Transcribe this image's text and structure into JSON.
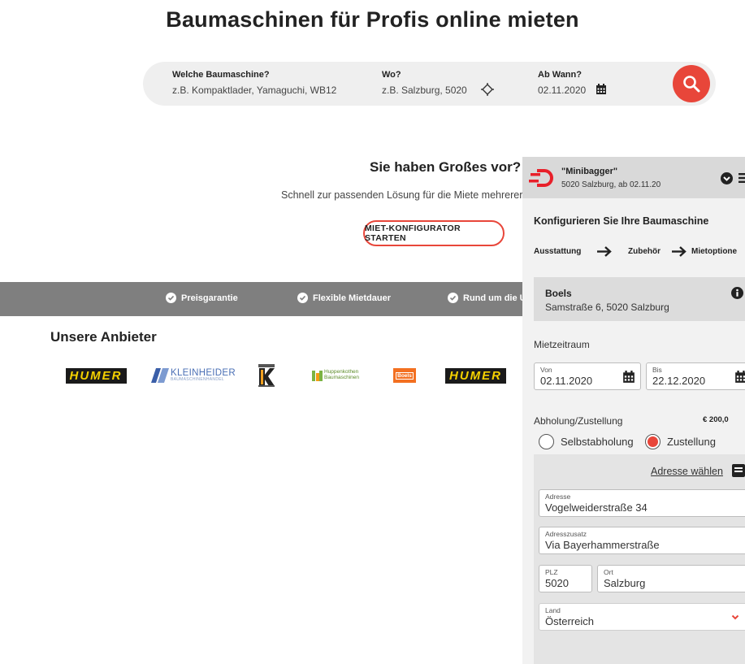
{
  "page_title": "Baumaschinen für Profis online mieten",
  "search": {
    "machine_label": "Welche Baumaschine?",
    "machine_placeholder": "z.B. Kompaktlader, Yamaguchi, WB12",
    "location_label": "Wo?",
    "location_placeholder": "z.B. Salzburg, 5020",
    "date_label": "Ab Wann?",
    "date_value": "02.11.2020",
    "location_icon": "crosshair-icon",
    "date_icon": "calendar-icon",
    "search_icon": "search-icon"
  },
  "promo": {
    "title": "Sie haben Großes vor?",
    "subtitle": "Schnell zur passenden Lösung für die Miete mehrerer Ba",
    "button": "MIET-KONFIGURATOR STARTEN"
  },
  "benefits": [
    "Preisgarantie",
    "Flexible Mietdauer",
    "Rund um die Uhr"
  ],
  "suppliers": {
    "title": "Unsere Anbieter",
    "logos": [
      "HUMER",
      "KLEINHEIDER",
      "KK",
      "Huppenkothen Baumaschinen",
      "Boels",
      "HUMER"
    ],
    "kleinheider_sub": "BAUMASCHINENHANDEL",
    "huppenkothen_line1": "Huppenkothen",
    "huppenkothen_line2": "Baumaschinen"
  },
  "panel": {
    "search_term": "\"Minibagger\"",
    "search_summary": "5020 Salzburg, ab 02.11.20",
    "config_title": "Konfigurieren Sie Ihre Baumaschine",
    "steps": [
      "Ausstattung",
      "Zubehör",
      "Mietoptione"
    ],
    "vendor_name": "Boels",
    "vendor_address": "Samstraße 6, 5020 Salzburg",
    "period_label": "Mietzeitraum",
    "from_label": "Von",
    "from_value": "02.11.2020",
    "to_label": "Bis",
    "to_value": "22.12.2020",
    "delivery_label": "Abholung/Zustellung",
    "delivery_price": "€ 200,0",
    "option_pickup": "Selbstabholung",
    "option_delivery": "Zustellung",
    "address_link": "Adresse wählen",
    "address_label": "Adresse",
    "address_value": "Vogelweiderstraße 34",
    "address2_label": "Adresszusatz",
    "address2_value": "Via Bayerhammerstraße",
    "zip_label": "PLZ",
    "zip_value": "5020",
    "city_label": "Ort",
    "city_value": "Salzburg",
    "country_label": "Land",
    "country_value": "Österreich"
  },
  "colors": {
    "accent": "#e8463a",
    "banner": "#7f7f7f",
    "humer_yellow": "#f5d100"
  }
}
